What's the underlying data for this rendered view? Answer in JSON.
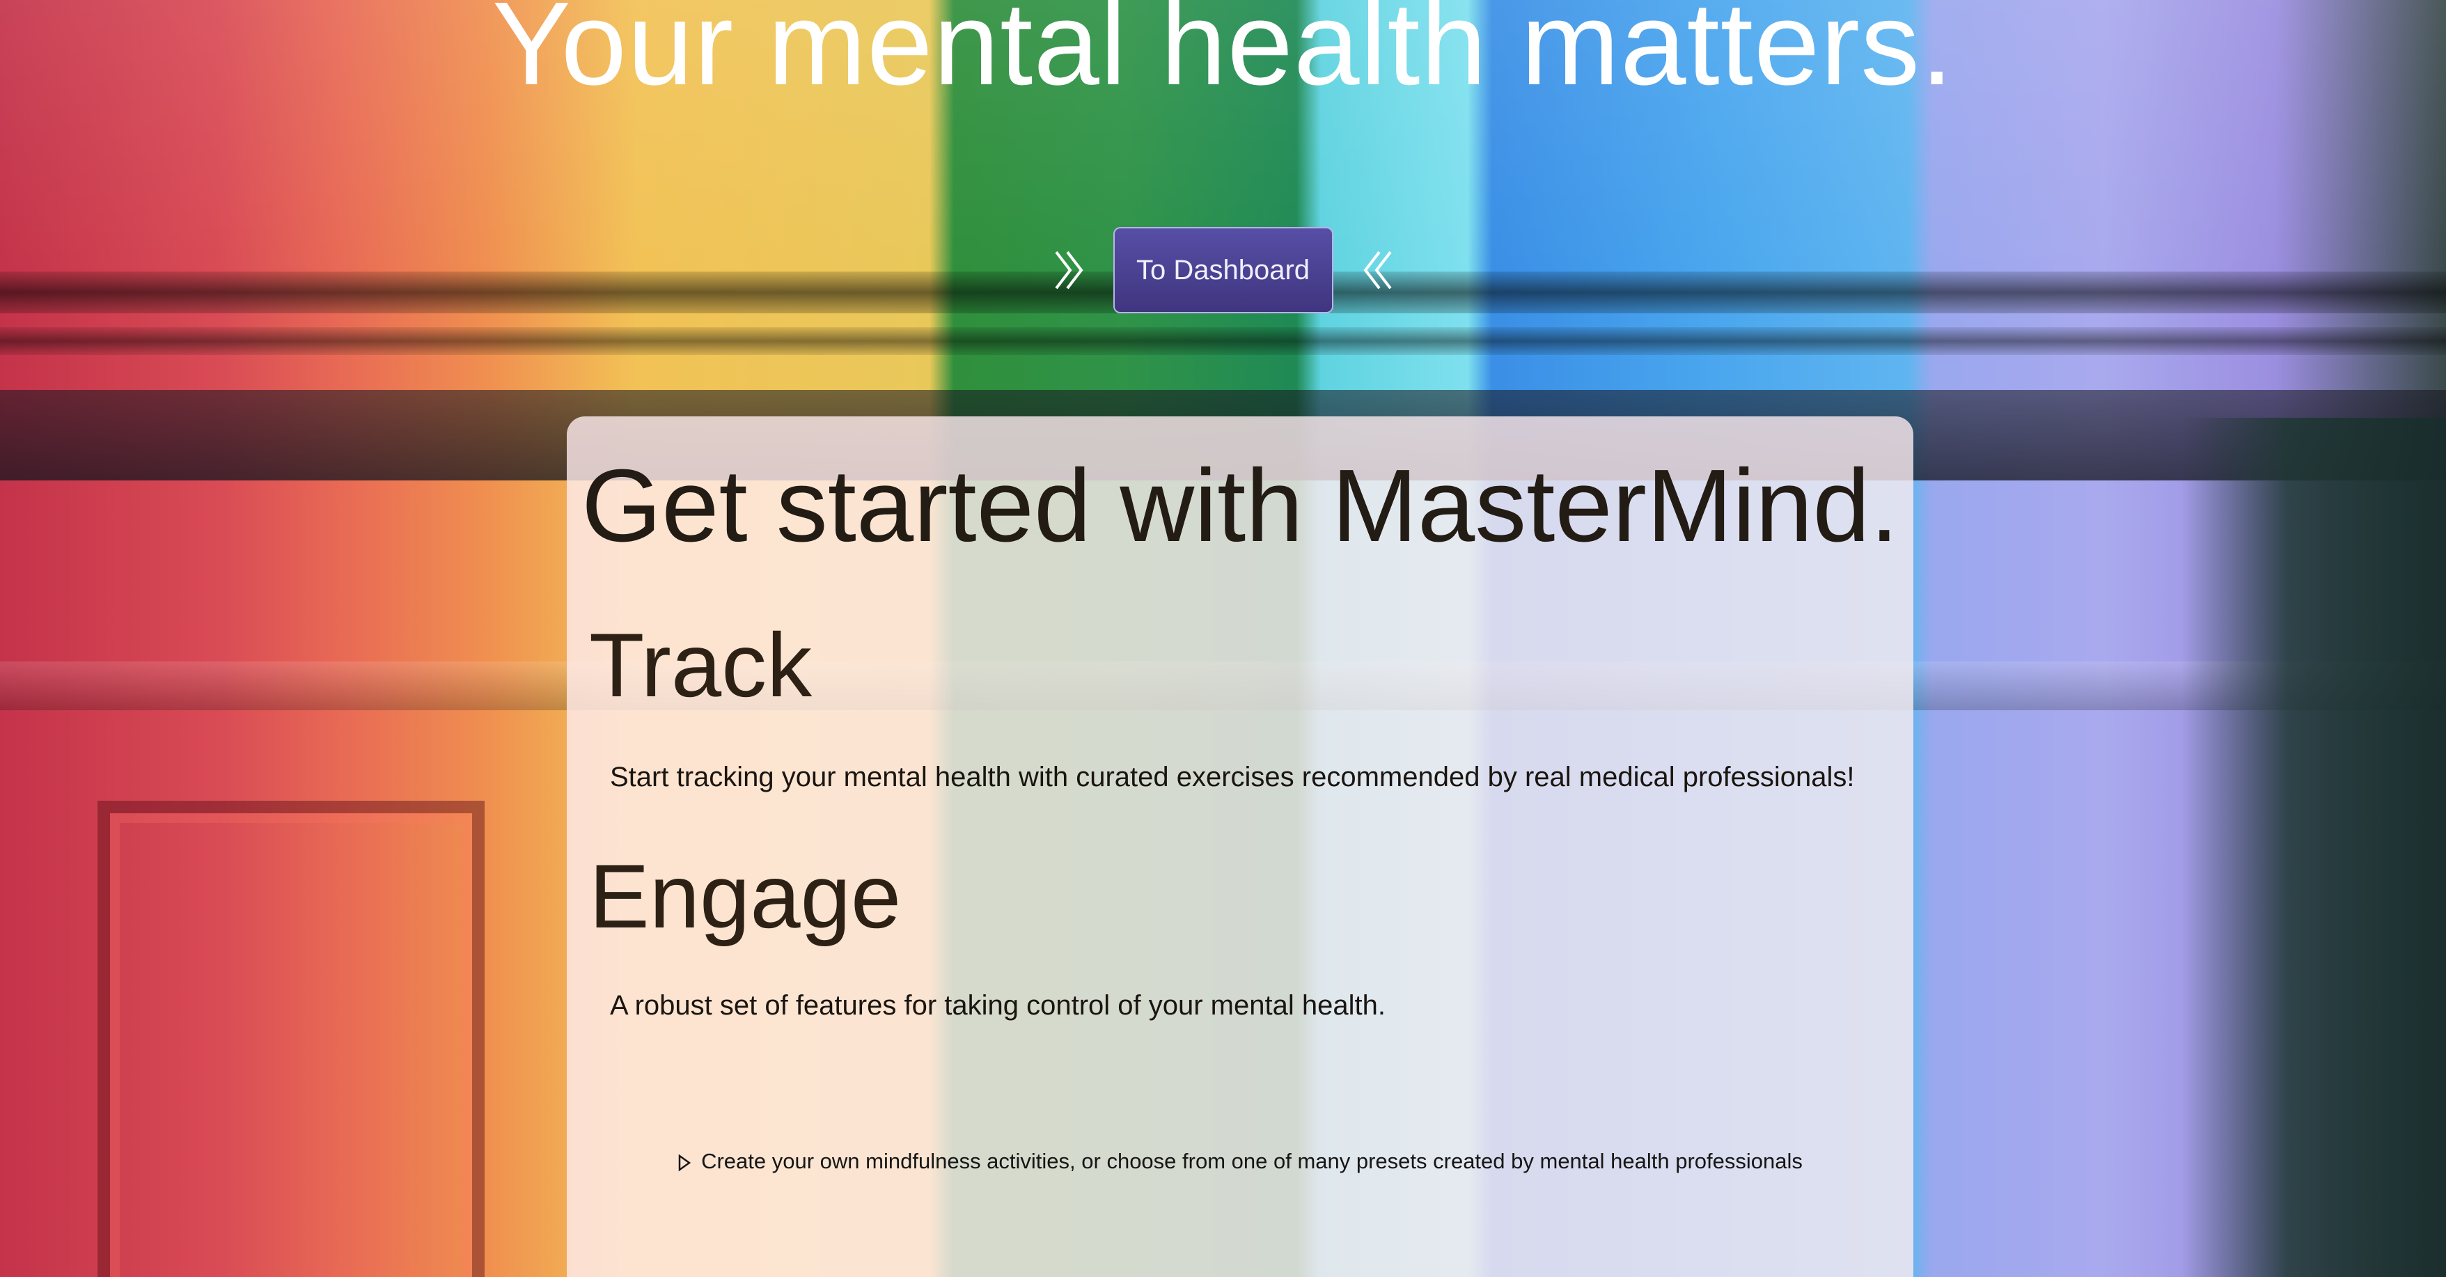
{
  "hero": {
    "title": "Your mental health matters."
  },
  "cta": {
    "button_label": "To Dashboard",
    "left_icon": "chevrons-right-icon",
    "right_icon": "chevrons-left-icon"
  },
  "card": {
    "title": "Get started with MasterMind.",
    "sections": [
      {
        "heading": "Track",
        "text": "Start tracking your mental health with curated exercises recommended by real medical professionals!"
      },
      {
        "heading": "Engage",
        "text": "A robust set of features for taking control of your mental health."
      }
    ],
    "details": {
      "icon": "disclosure-triangle-icon",
      "summary": "Create your own mindfulness activities, or choose from one of many presets created by mental health professionals"
    }
  },
  "colors": {
    "button_bg": "#4b4391",
    "card_bg": "#ffecf0",
    "hero_text": "#ffffff"
  }
}
